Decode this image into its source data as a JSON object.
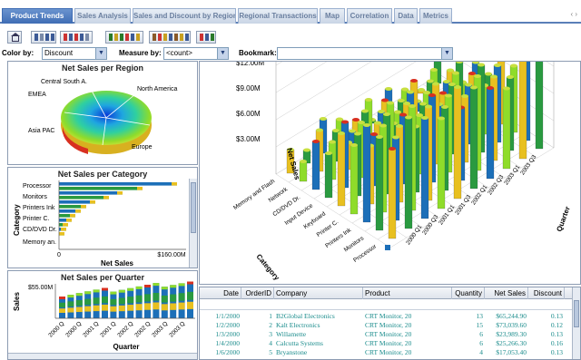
{
  "tabs": {
    "items": [
      "Product Trends",
      "Sales Analysis",
      "Sales and Discount by Region",
      "Regional Transactions",
      "Map",
      "Correlation",
      "Data",
      "Metrics"
    ],
    "active": 0,
    "nav": "‹ ›"
  },
  "toolbar": {
    "icons": [
      "home-icon",
      "save-icon",
      "print-icon",
      "calendar-icon",
      "chart-icon",
      "filter-icon",
      "edit-icon",
      "layout-icon",
      "settings-icon",
      "grid-icon",
      "table-icon"
    ]
  },
  "filters": {
    "color_by_label": "Color by:",
    "color_by_value": "Discount",
    "measure_by_label": "Measure by:",
    "measure_by_value": "<count>",
    "bookmark_label": "Bookmark:",
    "bookmark_value": ""
  },
  "pie": {
    "title": "Net Sales per Region",
    "labels": [
      "Central South A.",
      "North America",
      "EMEA",
      "Asia PAC",
      "Europe"
    ]
  },
  "category_chart": {
    "title": "Net Sales per Category",
    "ylabel": "Category",
    "xlabel": "Net Sales",
    "categories": [
      "Processor",
      "Monitors",
      "Printers Ink",
      "Printer C.",
      "CD/DVD Dr.",
      "Memory an."
    ],
    "tick_min": "0",
    "tick_max": "$160.00M"
  },
  "quarter_chart": {
    "title": "Net Sales per Quarter",
    "ylabel": "Sales",
    "xlabel": "Quarter",
    "tick_top": "$55.00M",
    "tick_labels": [
      "2000 Q",
      "2000 Q",
      "2001 Q",
      "2001 Q",
      "2002 Q",
      "2002 Q",
      "2003 Q",
      "2003 Q"
    ]
  },
  "chart3d": {
    "zticks": [
      "$12.00M",
      "$9.00M",
      "$6.00M",
      "$3.00M"
    ],
    "zlabel": "Net Sales",
    "xlabel": "Category",
    "ylabel": "Quarter",
    "categories": [
      "Processor",
      "Monitors",
      "Printers Ink",
      "Printer C.",
      "Keyboard",
      "Input Device",
      "CD/DVD Dr.",
      "Network",
      "Memory and Flash"
    ],
    "quarters": [
      "2000 Q1",
      "2000 Q3",
      "2001 Q1",
      "2001 Q3",
      "2002 Q1",
      "2002 Q3",
      "2003 Q1",
      "2003 Q3"
    ]
  },
  "grid": {
    "columns": [
      "Date",
      "OrderID",
      "Company",
      "Product",
      "Quantity",
      "Net Sales",
      "Discount"
    ],
    "rows": [
      [
        "1/1/2000",
        "1",
        "B2Global Electronics",
        "CRT Monitor, 20",
        "13",
        "$65,244.90",
        "0.13"
      ],
      [
        "1/2/2000",
        "2",
        "Kalt Electronics",
        "CRT Monitor, 20",
        "15",
        "$73,039.60",
        "0.12"
      ],
      [
        "1/3/2000",
        "3",
        "Willamette",
        "CRT Monitor, 20",
        "6",
        "$23,989.30",
        "0.13"
      ],
      [
        "1/4/2000",
        "4",
        "Calcutta Systems",
        "CRT Monitor, 20",
        "6",
        "$25,266.30",
        "0.16"
      ],
      [
        "1/6/2000",
        "5",
        "Bryanstone",
        "CRT Monitor, 20",
        "4",
        "$17,053.40",
        "0.13"
      ]
    ]
  }
}
